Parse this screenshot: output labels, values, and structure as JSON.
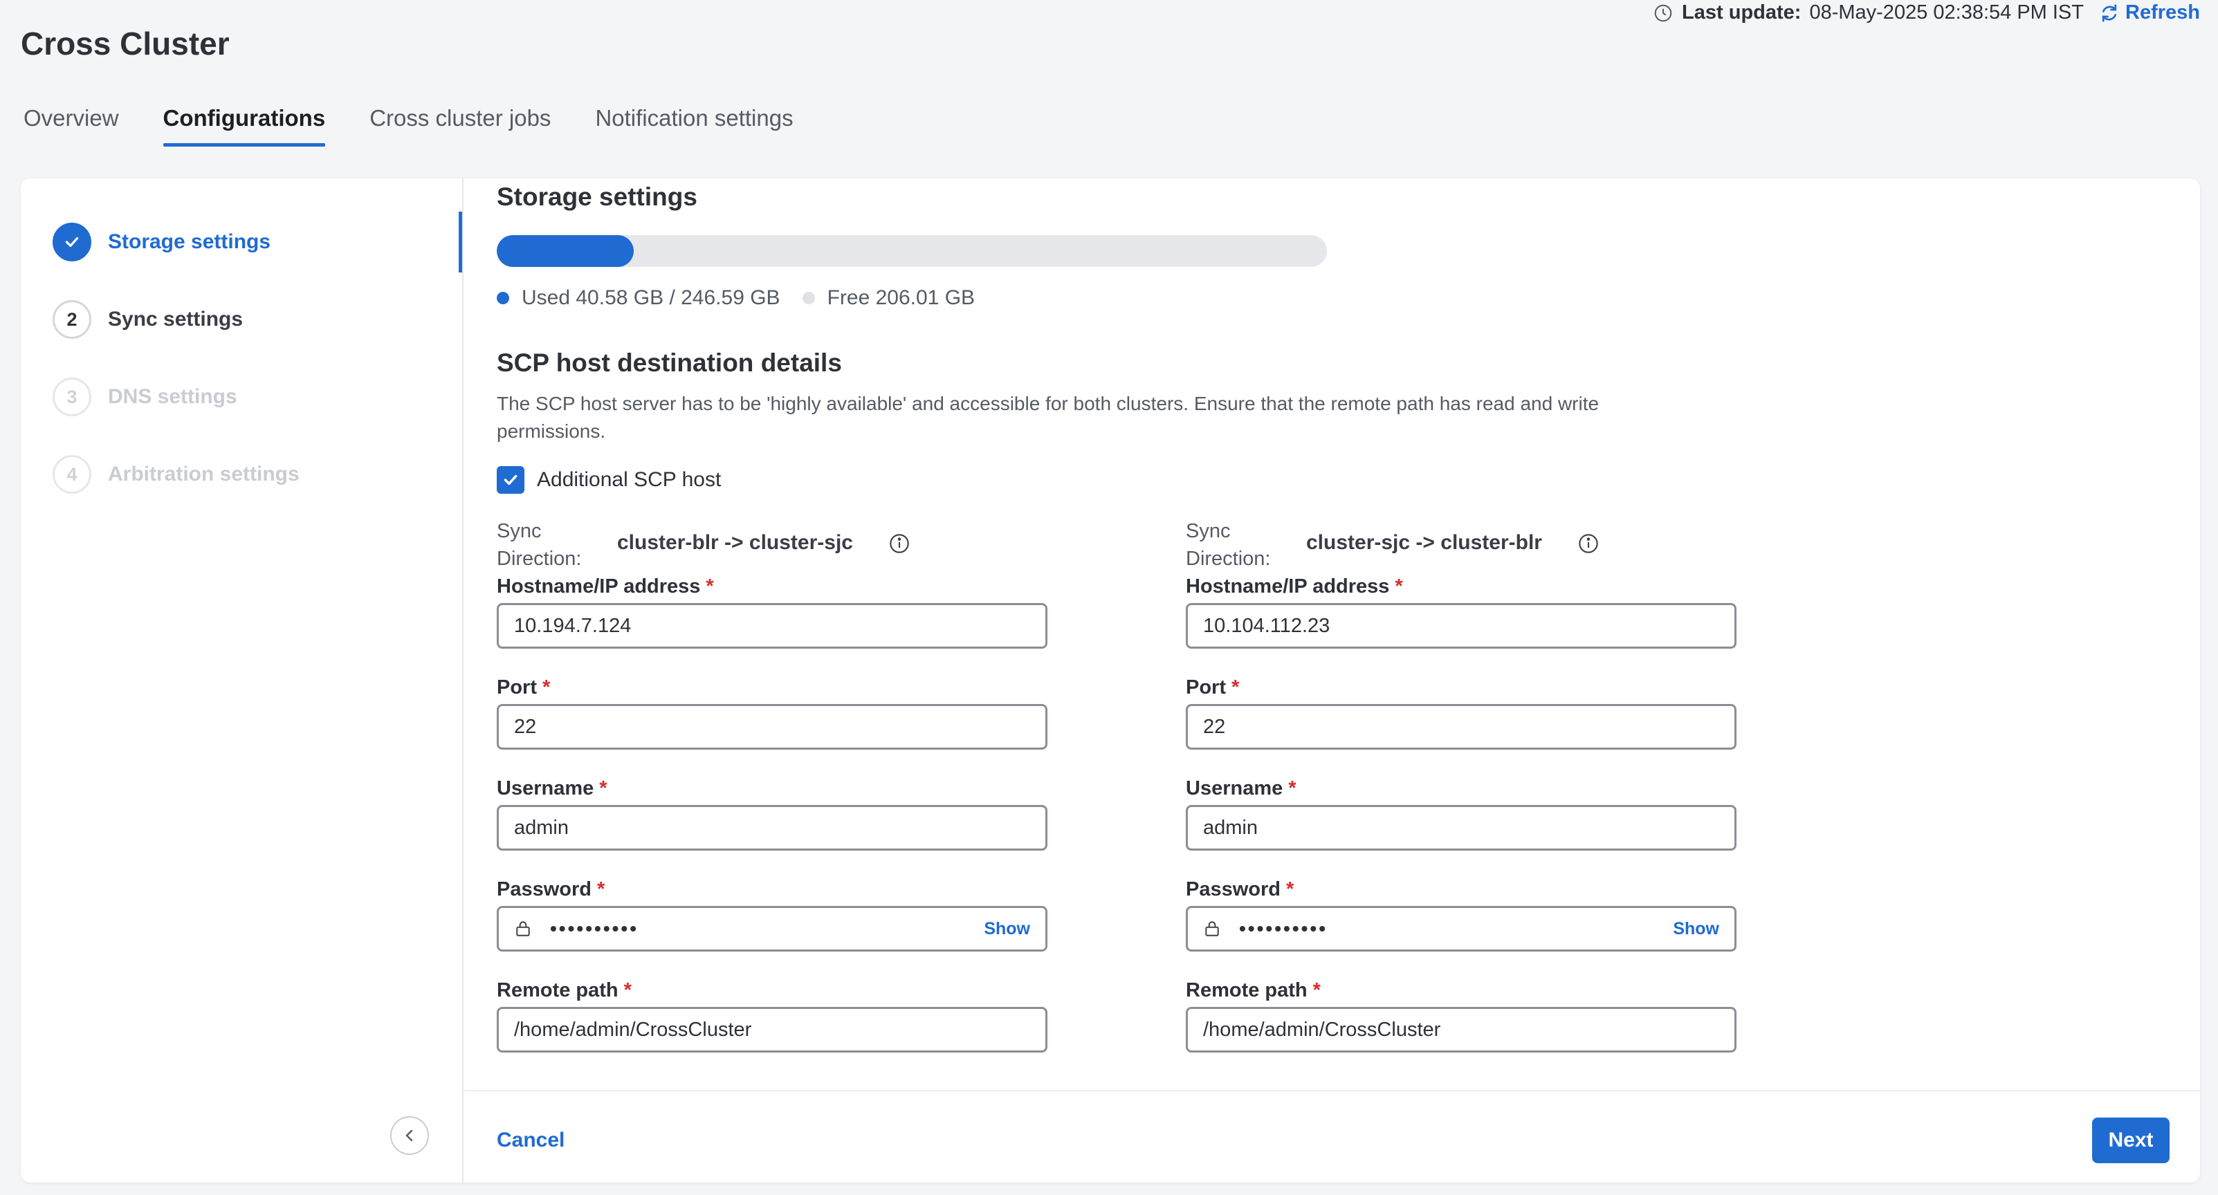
{
  "header": {
    "title": "Cross Cluster",
    "last_update_label": "Last update:",
    "last_update_value": "08-May-2025 02:38:54 PM IST",
    "refresh_label": "Refresh"
  },
  "tabs": [
    {
      "label": "Overview",
      "active": false
    },
    {
      "label": "Configurations",
      "active": true
    },
    {
      "label": "Cross cluster jobs",
      "active": false
    },
    {
      "label": "Notification settings",
      "active": false
    }
  ],
  "steps": [
    {
      "number": "1",
      "label": "Storage settings",
      "state": "done"
    },
    {
      "number": "2",
      "label": "Sync settings",
      "state": "current"
    },
    {
      "number": "3",
      "label": "DNS settings",
      "state": "disabled"
    },
    {
      "number": "4",
      "label": "Arbitration settings",
      "state": "disabled"
    }
  ],
  "storage": {
    "title": "Storage settings",
    "used_fraction": 0.1646,
    "used_label": "Used 40.58 GB / 246.59 GB",
    "free_label": "Free 206.01 GB",
    "used_color": "#1f6bd1",
    "free_color": "#e6e7ea"
  },
  "scp": {
    "title": "SCP host destination details",
    "description": "The SCP host server has to be 'highly available' and accessible for both clusters. Ensure that the remote path has read and write permissions.",
    "checkbox_label": "Additional SCP host",
    "checkbox_checked": true,
    "sync_label": "Sync Direction:",
    "labels": {
      "hostname": "Hostname/IP address",
      "port": "Port",
      "username": "Username",
      "password": "Password",
      "remote_path": "Remote path",
      "required": "*",
      "show": "Show"
    },
    "hosts": [
      {
        "direction": "cluster-blr -> cluster-sjc",
        "hostname": "10.194.7.124",
        "port": "22",
        "username": "admin",
        "password_mask": "••••••••••",
        "remote_path": "/home/admin/CrossCluster"
      },
      {
        "direction": "cluster-sjc -> cluster-blr",
        "hostname": "10.104.112.23",
        "port": "22",
        "username": "admin",
        "password_mask": "••••••••••",
        "remote_path": "/home/admin/CrossCluster"
      }
    ]
  },
  "footer": {
    "cancel_label": "Cancel",
    "next_label": "Next"
  },
  "colors": {
    "accent": "#1f6bd1",
    "required": "#d72c2c"
  }
}
